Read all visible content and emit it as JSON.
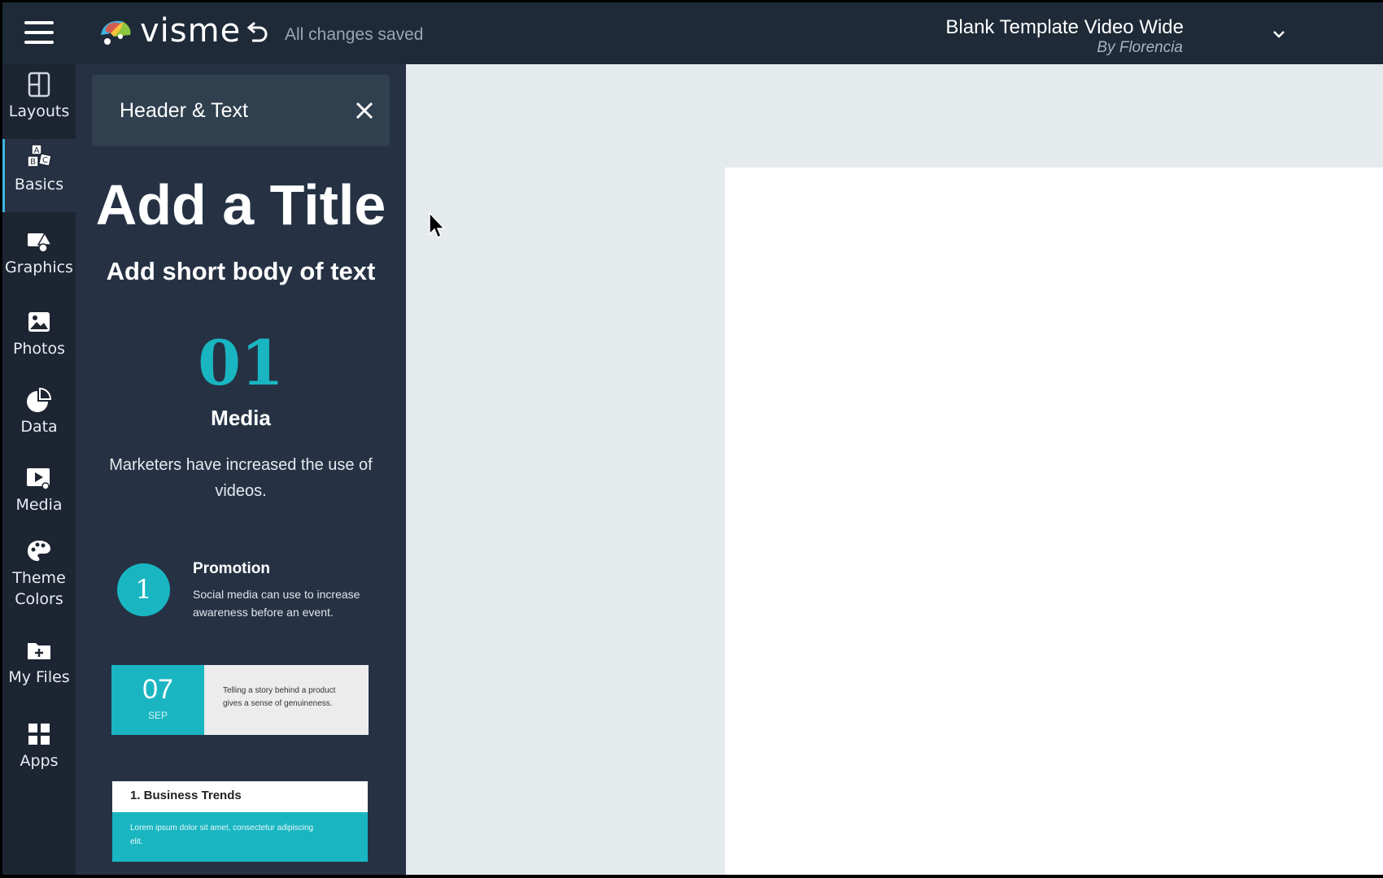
{
  "app": {
    "logo_text": "visme",
    "save_status": "All changes saved",
    "document_title": "Blank Template Video Wide",
    "document_author": "By Florencia",
    "icons": {
      "menu": "hamburger-menu-icon",
      "undo": "undo-icon",
      "dropdown": "chevron-down-icon"
    }
  },
  "nav": {
    "items": [
      {
        "label": "Layouts",
        "icon": "layouts-icon"
      },
      {
        "label": "Basics",
        "icon": "basics-blocks-icon",
        "active": true
      },
      {
        "label": "Graphics",
        "icon": "graphics-icon"
      },
      {
        "label": "Photos",
        "icon": "photos-icon"
      },
      {
        "label": "Data",
        "icon": "pie-chart-icon"
      },
      {
        "label": "Media",
        "icon": "media-icon"
      },
      {
        "label": "Theme\nColors",
        "label_line1": "Theme",
        "label_line2": "Colors",
        "icon": "palette-icon"
      },
      {
        "label": "My Files",
        "icon": "folder-add-icon"
      },
      {
        "label": "Apps",
        "icon": "apps-grid-icon"
      }
    ]
  },
  "panel": {
    "header": "Header & Text",
    "title_sample": "Add a Title",
    "body_sample": "Add short body of text",
    "number_block": {
      "number": "01",
      "title": "Media",
      "text": "Marketers have increased the use of videos."
    },
    "promo_block": {
      "number": "1",
      "title": "Promotion",
      "text": "Social media can use to increase awareness before an event."
    },
    "date_block": {
      "day": "07",
      "month": "SEP",
      "text": "Telling a story behind a product gives a sense of genuineness."
    },
    "business_block": {
      "title": "1. Business Trends",
      "text": "Lorem ipsum dolor sit amet, consectetur adipiscing elit."
    }
  },
  "colors": {
    "topbar": "#1f2a38",
    "panel": "#263244",
    "accent": "#19b6c2",
    "workspace": "#e5eaed"
  }
}
